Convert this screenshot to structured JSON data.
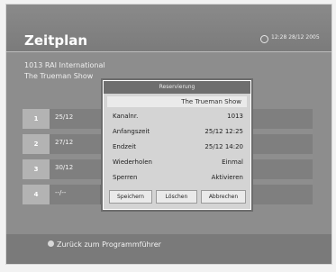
{
  "header": {
    "title": "Zeitplan",
    "clock": "12:28 28/12 2005"
  },
  "info": {
    "channel": "1013 RAI International",
    "program": "The Trueman Show"
  },
  "rows": [
    {
      "num": "1",
      "date": "25/12"
    },
    {
      "num": "2",
      "date": "27/12"
    },
    {
      "num": "3",
      "date": "30/12"
    },
    {
      "num": "4",
      "date": "--/--"
    }
  ],
  "dialog": {
    "title": "Reservierung",
    "program": "The Trueman Show",
    "fields": [
      {
        "label": "Kanalnr.",
        "value": "1013"
      },
      {
        "label": "Anfangszeit",
        "value": "25/12 12:25"
      },
      {
        "label": "Endzeit",
        "value": "25/12 14:20"
      },
      {
        "label": "Wiederholen",
        "value": "Einmal"
      },
      {
        "label": "Sperren",
        "value": "Aktivieren"
      }
    ],
    "buttons": {
      "save": "Speichern",
      "delete": "Löschen",
      "cancel": "Abbrechen"
    }
  },
  "footer": {
    "text": "Zurück zum Programmführer"
  }
}
